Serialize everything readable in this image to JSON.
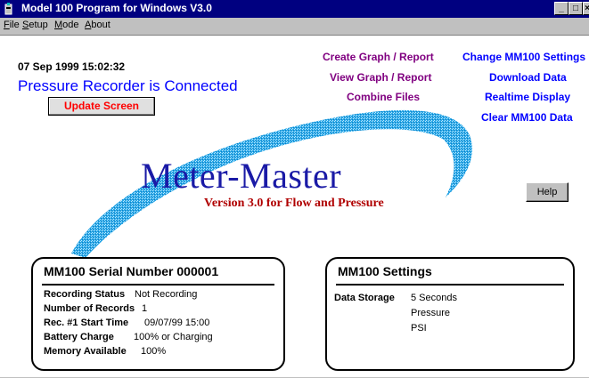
{
  "window": {
    "title": "Model 100 Program for Windows V3.0",
    "buttons": {
      "minimize": "_",
      "maximize": "□",
      "close": "×"
    }
  },
  "menu": [
    "File",
    "Setup",
    "Mode",
    "About"
  ],
  "status": {
    "datetime": "07 Sep 1999 15:02:32",
    "connection": "Pressure Recorder is Connected",
    "update_label": "Update Screen"
  },
  "links": {
    "create_graph": "Create Graph / Report",
    "view_graph": "View Graph / Report",
    "combine_files": "Combine Files",
    "change_settings": "Change MM100 Settings",
    "download_data": "Download Data",
    "realtime_display": "Realtime Display",
    "clear_data": "Clear MM100 Data"
  },
  "help_label": "Help",
  "logo": {
    "title": "Meter-Master",
    "subtitle": "Version 3.0 for Flow and Pressure"
  },
  "serial_panel": {
    "title": "MM100 Serial Number  000001",
    "rows": [
      {
        "label": "Recording Status",
        "value": "Not Recording"
      },
      {
        "label": "Number of Records",
        "value": "1"
      },
      {
        "label": "Rec. #1 Start Time",
        "value": "09/07/99 15:00"
      },
      {
        "label": "Battery Charge",
        "value": "100% or Charging"
      },
      {
        "label": "Memory Available",
        "value": "100%"
      }
    ]
  },
  "settings_panel": {
    "title": "MM100 Settings",
    "label": "Data Storage",
    "values": [
      "5 Seconds",
      "Pressure",
      "PSI"
    ]
  },
  "colors": {
    "titlebar": "#000080",
    "status_text": "#0000ff",
    "update_text": "#ff0000",
    "link_purple": "#800080",
    "link_blue": "#0000ff",
    "logo_blue": "#1a1aa6",
    "logo_red": "#b00000",
    "swoosh": "#29a8e8"
  }
}
